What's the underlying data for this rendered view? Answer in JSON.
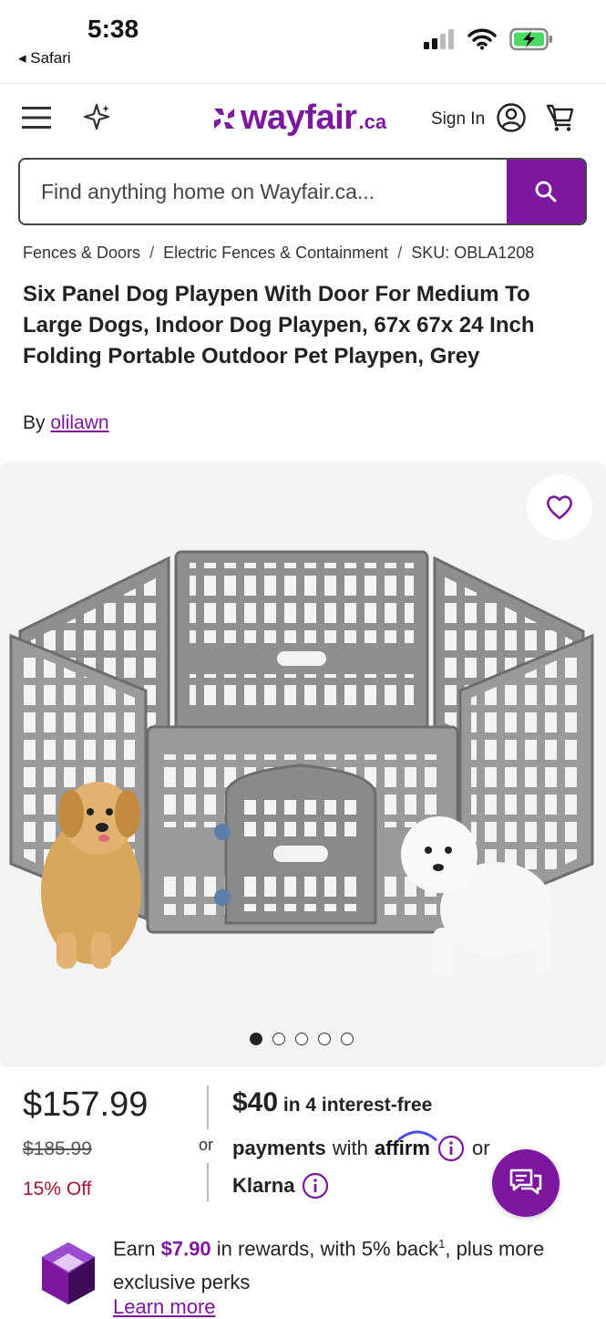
{
  "status_bar": {
    "time": "5:38",
    "back_label": "◂ Safari"
  },
  "header": {
    "logo_text": "wayfair",
    "logo_suffix": ".ca",
    "sign_in_label": "Sign In"
  },
  "search": {
    "placeholder": "Find anything home on Wayfair.ca..."
  },
  "breadcrumb": {
    "items": [
      "Fences & Doors",
      "Electric Fences & Containment",
      "SKU: OBLA1208"
    ],
    "separator": "/"
  },
  "product": {
    "title": "Six Panel Dog Playpen With Door For Medium To Large Dogs, Indoor Dog Playpen, 67x 67x 24 Inch Folding Portable Outdoor Pet Playpen, Grey",
    "by_label": "By",
    "brand": "olilawn"
  },
  "gallery": {
    "image_count": 5,
    "active_index": 0
  },
  "pricing": {
    "price": "$157.99",
    "was_price": "$185.99",
    "discount": "15% Off",
    "or_label": "or",
    "installment_amount": "$40",
    "installment_text": "in 4 interest-free",
    "payments_label": "payments",
    "with_label": "with",
    "affirm_label": "affirm",
    "or_label2": "or",
    "klarna_label": "Klarna"
  },
  "rewards": {
    "earn_label": "Earn",
    "amount": "$7.90",
    "text_a": "in rewards, with 5% back",
    "footnote": "1",
    "text_b": ", plus more exclusive perks",
    "learn_more": "Learn more"
  },
  "colors": {
    "brand": "#7b189f",
    "discount": "#a3162f",
    "gallery_bg": "#f3f3f3"
  }
}
